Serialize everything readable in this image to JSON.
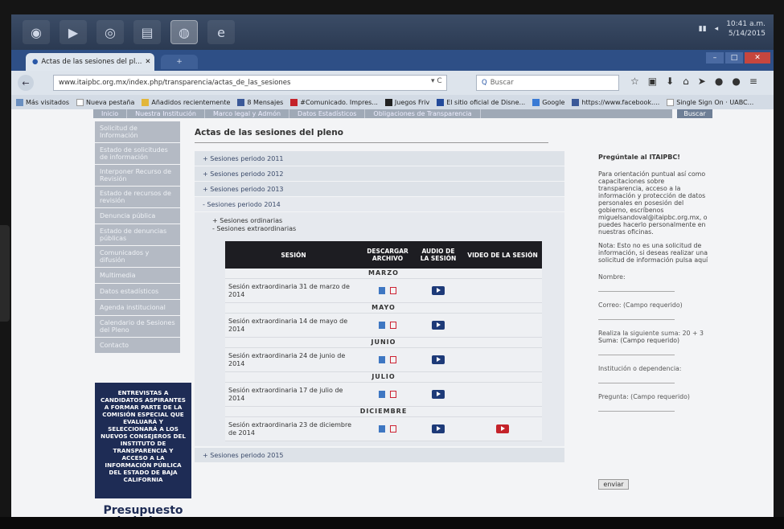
{
  "taskbar": {
    "clock_time": "10:41 a.m.",
    "clock_date": "5/14/2015"
  },
  "browser": {
    "tab_title": "Actas de las sesiones del pl...",
    "tab_close": "✕",
    "url": "www.itaipbc.org.mx/index.php/transparencia/actas_de_las_sesiones",
    "search_placeholder": "Buscar",
    "bookmarks": [
      "Más visitados",
      "Nueva pestaña",
      "Añadidos recientemente",
      "8 Mensajes",
      "#Comunicado. Impres...",
      "Juegos Friv",
      "El sitio oficial de Disne...",
      "Google",
      "https://www.facebook....",
      "Single Sign On · UABC..."
    ]
  },
  "site_menu": {
    "items": [
      "Inicio",
      "Nuestra Institución",
      "Marco legal y Admón",
      "Datos Estadísticos",
      "Obligaciones de Transparencia"
    ],
    "search_label": "Buscar"
  },
  "sidebar": {
    "items": [
      "Solicitud de Información",
      "Estado de solicitudes de información",
      "Interponer Recurso de Revisión",
      "Estado de recursos de revisión",
      "Denuncia pública",
      "Estado de denuncias públicas",
      "Comunicados y difusión",
      "Multimedia",
      "Datos estadísticos",
      "Agenda institucional",
      "Calendario de Sesiones del Pleno",
      "Contacto"
    ],
    "promo_text": "Entrevistas a candidatos aspirantes a formar parte de la comisión especial que evaluará y seleccionará a los nuevos consejeros del Instituto de Transparencia y Acceso a la Información Pública del Estado de Baja California",
    "presupuesto": "Presupuesto ciudadano"
  },
  "main": {
    "title": "Actas de las sesiones del pleno",
    "periods": [
      "+ Sesiones periodo 2011",
      "+ Sesiones periodo 2012",
      "+ Sesiones periodo 2013"
    ],
    "open_period": "- Sesiones periodo 2014",
    "sub_ordinarias": "+ Sesiones ordinarias",
    "sub_extraordinarias": "- Sesiones extraordinarias",
    "table_headers": {
      "session": "SESIÓN",
      "download": "DESCARGAR ARCHIVO",
      "audio": "AUDIO DE LA SESIÓN",
      "video": "VIDEO DE LA SESIÓN"
    },
    "months": [
      "MARZO",
      "MAYO",
      "JUNIO",
      "JULIO",
      "DICIEMBRE"
    ],
    "rows": [
      "Sesión extraordinaria 31 de marzo de 2014",
      "Sesión extraordinaria 14 de mayo de 2014",
      "Sesión extraordinaria 24 de junio de 2014",
      "Sesión extraordinaria 17 de julio de 2014",
      "Sesión extraordinaria 23 de diciembre de 2014"
    ],
    "last_period": "+ Sesiones periodo 2015"
  },
  "right": {
    "title": "Pregúntale al ITAIPBC!",
    "text": "Para orientación puntual así como capacitaciones sobre transparencia, acceso a la información y protección de datos personales en posesión del gobierno, escríbenos miguelsandoval@itaipbc.org.mx, o puedes hacerlo personalmente en nuestras oficinas.",
    "note": "Nota: Esto no es una solicitud de información, si deseas realizar una solicitud de información pulsa aquí",
    "field_name": "Nombre:",
    "field_email": "Correo: (Campo requerido)",
    "field_sum": "Realiza la siguiente suma: 20 + 3",
    "field_sum2": "Suma: (Campo requerido)",
    "field_institution": "Institución o dependencia:",
    "field_question": "Pregunta: (Campo requerido)",
    "send": "enviar"
  },
  "colors": {
    "promo_bg": "#1e2c55",
    "header_bg": "#1d1d22",
    "play_blue": "#1d3a78",
    "play_red": "#c4232a"
  }
}
